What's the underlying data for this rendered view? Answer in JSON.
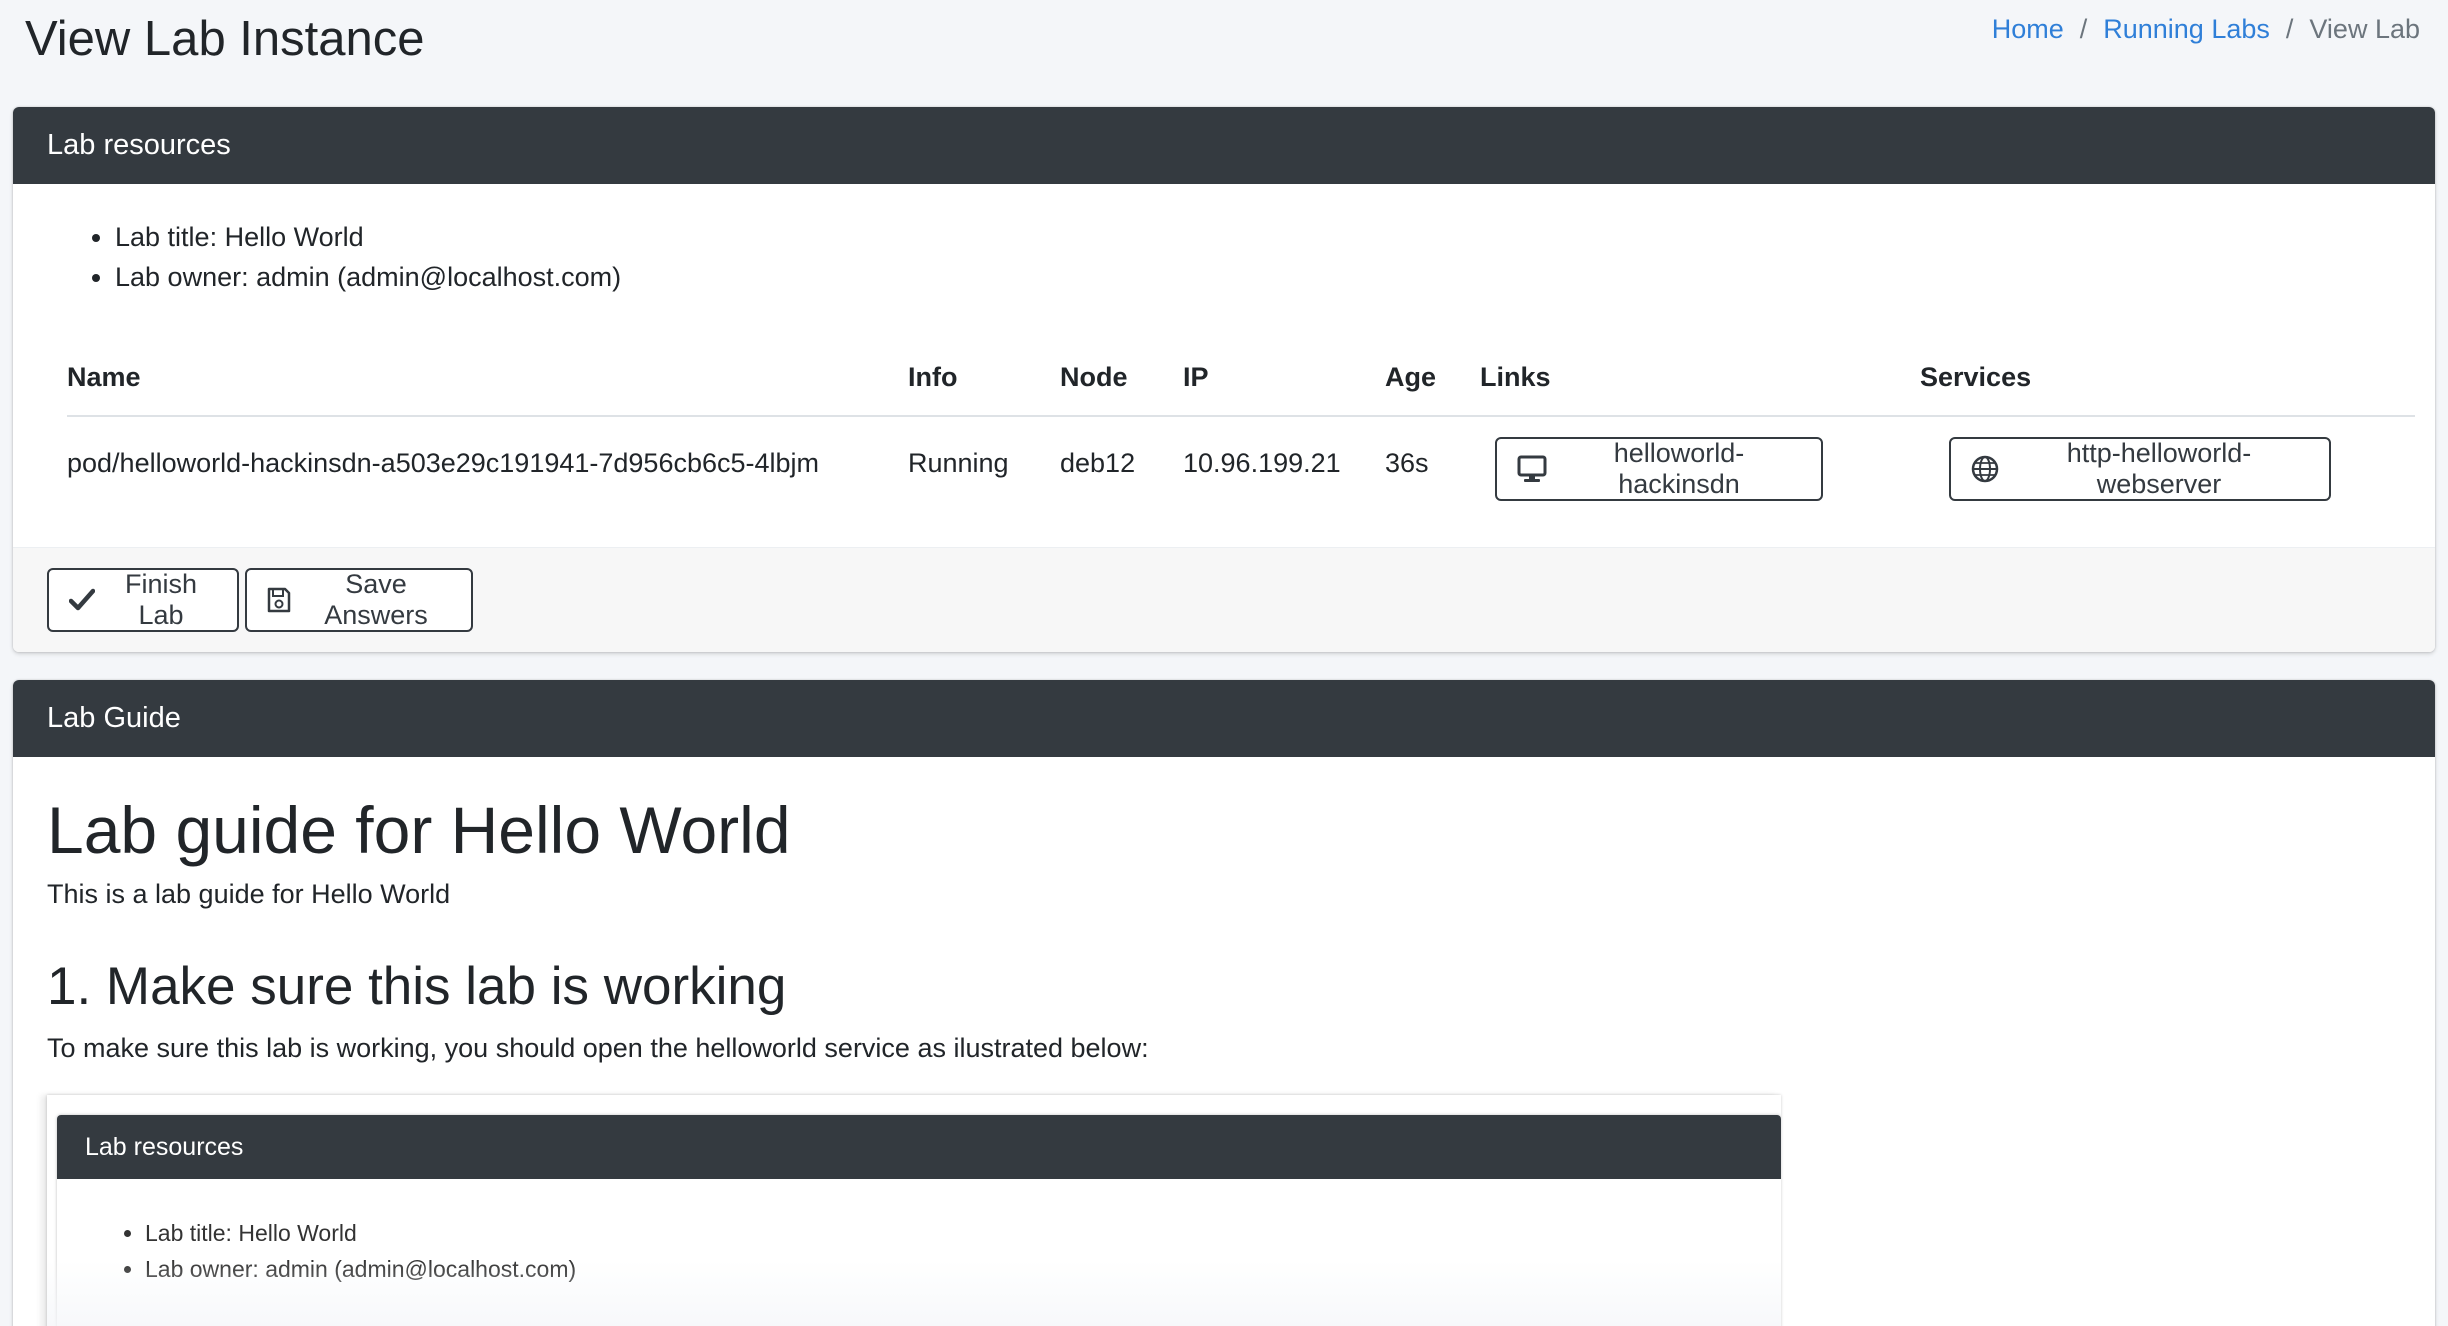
{
  "page": {
    "title": "View Lab Instance"
  },
  "breadcrumb": {
    "home": "Home",
    "sep1": "/",
    "running_labs": "Running Labs",
    "sep2": "/",
    "current": "View Lab"
  },
  "resources": {
    "header": "Lab resources",
    "items": [
      "Lab title: Hello World",
      "Lab owner: admin (admin@localhost.com)"
    ],
    "table": {
      "headers": [
        "Name",
        "Info",
        "Node",
        "IP",
        "Age",
        "Links",
        "Services"
      ],
      "rows": [
        {
          "name": "pod/helloworld-hackinsdn-a503e29c191941-7d956cb6c5-4lbjm",
          "info": "Running",
          "node": "deb12",
          "ip": "10.96.199.21",
          "age": "36s",
          "link_label": "helloworld-hackinsdn",
          "link_icon": "desktop-icon",
          "service_label": "http-helloworld-webserver",
          "service_icon": "globe-icon"
        }
      ]
    },
    "footer": {
      "finish_label": "Finish Lab",
      "finish_icon": "check-icon",
      "save_label": "Save Answers",
      "save_icon": "floppy-disk-icon"
    }
  },
  "guide": {
    "header": "Lab Guide",
    "h1": "Lab guide for Hello World",
    "intro": "This is a lab guide for Hello World",
    "h2": "1. Make sure this lab is working",
    "p2": "To make sure this lab is working, you should open the helloworld service as ilustrated below:",
    "embed": {
      "header": "Lab resources",
      "items": [
        "Lab title: Hello World",
        "Lab owner: admin (admin@localhost.com)"
      ]
    }
  },
  "colors": {
    "card_header": "#343a40",
    "link": "#2f7fd8",
    "background": "#f4f6f9"
  }
}
